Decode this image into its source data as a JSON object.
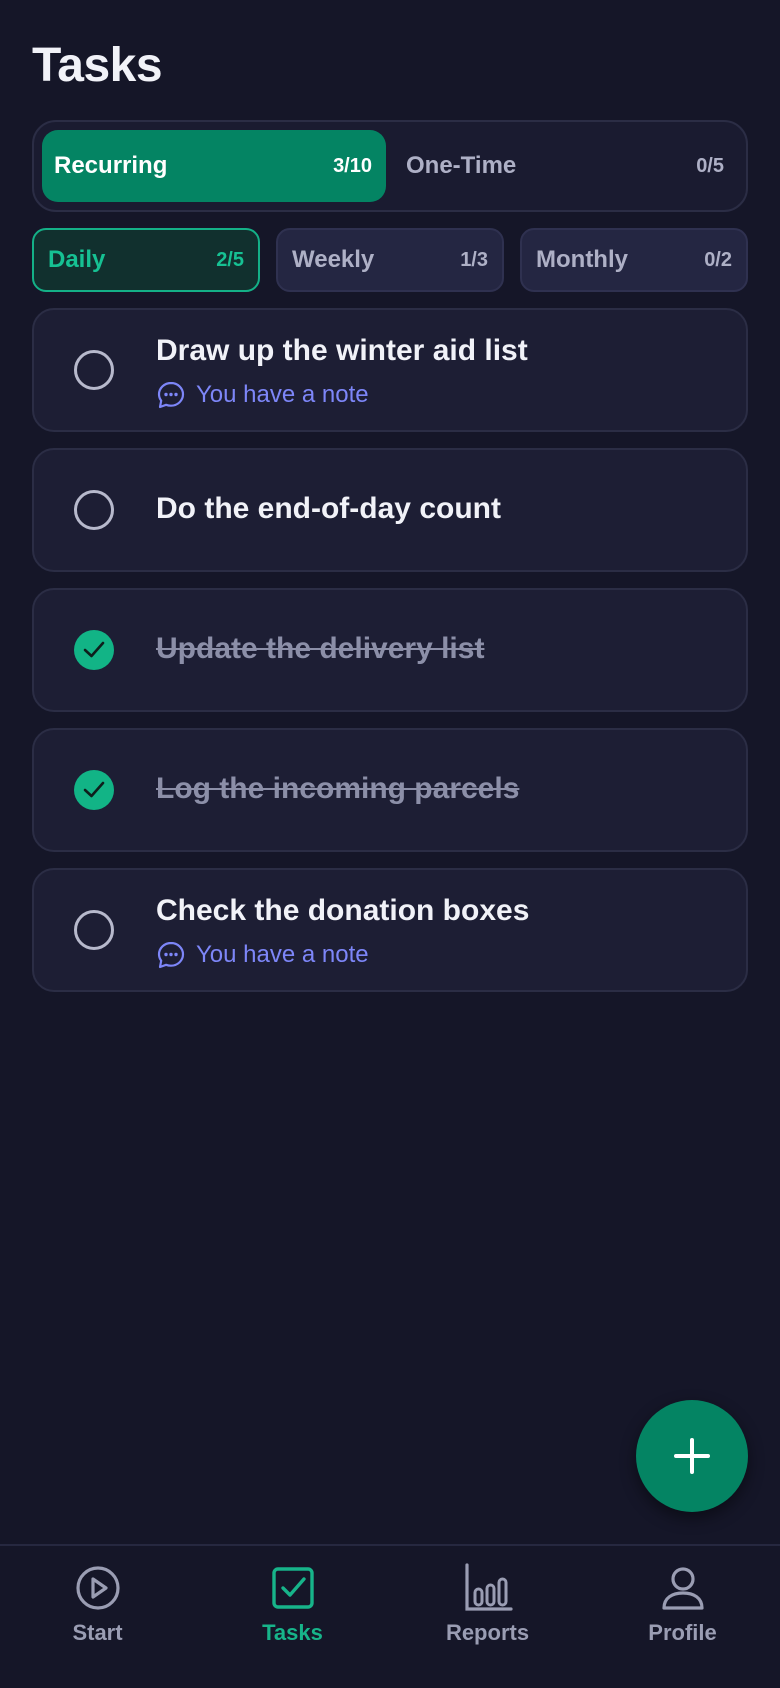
{
  "header": {
    "title": "Tasks"
  },
  "segment": {
    "recurring": {
      "label": "Recurring",
      "count": "3/10"
    },
    "onetime": {
      "label": "One-Time",
      "count": "0/5"
    }
  },
  "periods": [
    {
      "label": "Daily",
      "count": "2/5",
      "active": true
    },
    {
      "label": "Weekly",
      "count": "1/3",
      "active": false
    },
    {
      "label": "Monthly",
      "count": "0/2",
      "active": false
    }
  ],
  "tasks": [
    {
      "title": "Draw up the winter aid list",
      "done": false,
      "note": "You have a note"
    },
    {
      "title": "Do the end-of-day count",
      "done": false,
      "note": ""
    },
    {
      "title": "Update the delivery list",
      "done": true,
      "note": ""
    },
    {
      "title": "Log the incoming parcels",
      "done": true,
      "note": ""
    },
    {
      "title": "Check the donation boxes",
      "done": false,
      "note": "You have a note"
    }
  ],
  "fab": {
    "icon": "plus-icon"
  },
  "nav": {
    "items": [
      {
        "label": "Start",
        "icon": "play-circle-icon",
        "active": false
      },
      {
        "label": "Tasks",
        "icon": "checkbox-icon",
        "active": true
      },
      {
        "label": "Reports",
        "icon": "bar-chart-icon",
        "active": false
      },
      {
        "label": "Profile",
        "icon": "user-icon",
        "active": false
      }
    ]
  },
  "colors": {
    "background": "#151628",
    "accent": "#048463",
    "accent_text": "#16C193",
    "note": "#7D86F8"
  }
}
